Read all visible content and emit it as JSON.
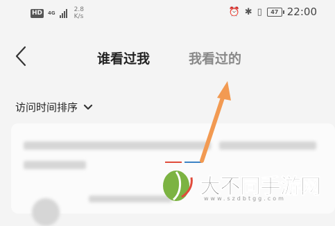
{
  "status_bar": {
    "hd": "HD",
    "network": "4G",
    "speed_value": "2.8",
    "speed_unit": "K/s",
    "battery": "47",
    "time": "22:00"
  },
  "nav": {
    "tabs": [
      {
        "label": "谁看过我",
        "active": true
      },
      {
        "label": "我看过的",
        "active": false
      }
    ]
  },
  "sort": {
    "label": "访问时间排序"
  },
  "watermark": {
    "text": "大不同手游网",
    "url": "www.szdbtgg.com"
  },
  "colors": {
    "arrow": "#f29a52",
    "accent_red": "#e04b3a",
    "accent_blue": "#3b82c4",
    "logo_green": "#7cb342"
  },
  "icons": [
    "alarm-icon",
    "bluetooth-icon",
    "vibrate-icon",
    "battery-icon",
    "back-arrow-icon",
    "chevron-down-icon"
  ]
}
